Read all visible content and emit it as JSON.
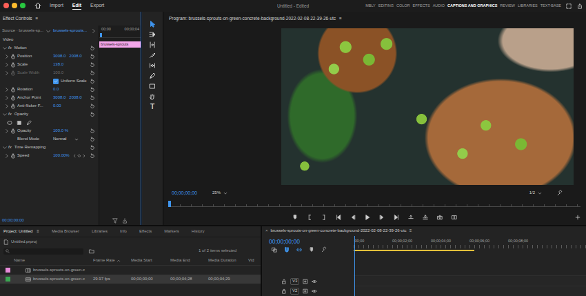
{
  "menu_bar": {
    "tabs": [
      {
        "label": "Import",
        "selected": false
      },
      {
        "label": "Edit",
        "selected": true
      },
      {
        "label": "Export",
        "selected": false
      }
    ],
    "title": "Untitled - Edited",
    "workspaces": [
      {
        "label": "MBLY",
        "selected": false
      },
      {
        "label": "EDITING",
        "selected": false
      },
      {
        "label": "COLOR",
        "selected": false
      },
      {
        "label": "EFFECTS",
        "selected": false
      },
      {
        "label": "AUDIO",
        "selected": false
      },
      {
        "label": "CAPTIONS AND GRAPHICS",
        "selected": true
      },
      {
        "label": "REVIEW",
        "selected": false
      },
      {
        "label": "LIBRARIES",
        "selected": false
      },
      {
        "label": "TEXT-BASE",
        "selected": false
      }
    ]
  },
  "effect_controls": {
    "title": "Effect Controls",
    "menu": "≡",
    "source": "Source · brussels-sp...",
    "clip": "brussels-sprouts...",
    "ruler": [
      "00;00",
      "00;00;04"
    ],
    "clip_bar": "brussels-sprouts",
    "timecode": "00;00;00;00",
    "rows": [
      {
        "kind": "section",
        "label": "Video"
      },
      {
        "kind": "effect",
        "fx": "fx",
        "label": "Motion",
        "expanded": true
      },
      {
        "kind": "param",
        "label": "Position",
        "values": [
          "3008.0",
          "2008.0"
        ],
        "expanded": false,
        "disabled": false,
        "keyframe_nav": false
      },
      {
        "kind": "param",
        "label": "Scale",
        "values": [
          "138.0"
        ],
        "expanded": false,
        "disabled": false,
        "keyframe_nav": false
      },
      {
        "kind": "param",
        "label": "Scale Width",
        "values": [
          "100.0"
        ],
        "expanded": false,
        "disabled": true,
        "keyframe_nav": false
      },
      {
        "kind": "checkbox",
        "label": "Uniform Scale",
        "checked": true
      },
      {
        "kind": "param",
        "label": "Rotation",
        "values": [
          "0.0"
        ],
        "expanded": false,
        "disabled": false,
        "keyframe_nav": false
      },
      {
        "kind": "param",
        "label": "Anchor Point",
        "values": [
          "3008.0",
          "2008.0"
        ],
        "expanded": false,
        "disabled": false,
        "keyframe_nav": false
      },
      {
        "kind": "param",
        "label": "Anti-flicker F...",
        "values": [
          "0.00"
        ],
        "expanded": false,
        "disabled": false,
        "keyframe_nav": false
      },
      {
        "kind": "effect",
        "fx": "fx",
        "label": "Opacity",
        "expanded": true
      },
      {
        "kind": "masks"
      },
      {
        "kind": "param",
        "label": "Opacity",
        "values": [
          "100.0 %"
        ],
        "expanded": false,
        "disabled": false,
        "keyframe_nav": false
      },
      {
        "kind": "select",
        "label": "Blend Mode",
        "value": "Normal"
      },
      {
        "kind": "effect",
        "fx": "fx",
        "label": "Time Remapping",
        "expanded": true
      },
      {
        "kind": "param",
        "label": "Speed",
        "values": [
          "100.00%"
        ],
        "expanded": false,
        "disabled": false,
        "keyframe_nav": true
      }
    ]
  },
  "tools": [
    {
      "kind": "selection",
      "selected": true
    },
    {
      "kind": "track-select",
      "selected": false
    },
    {
      "kind": "ripple",
      "selected": false
    },
    {
      "kind": "razor",
      "selected": false
    },
    {
      "kind": "slip",
      "selected": false
    },
    {
      "kind": "pen",
      "selected": false
    },
    {
      "kind": "rectangle",
      "selected": false
    },
    {
      "kind": "hand",
      "selected": false
    },
    {
      "kind": "type",
      "glyph": "T",
      "selected": false
    }
  ],
  "program": {
    "title": "Program: brussels-sprouts-on-green-concrete-background-2022-02-08-22-39-26-utc",
    "menu": "≡",
    "timecode": "00;00;00;00",
    "zoom": "25%",
    "resolution": "1/2",
    "playhead": 0
  },
  "project": {
    "tabs": [
      {
        "label": "Project: Untitled",
        "selected": true
      },
      {
        "label": "Media Browser",
        "selected": false
      },
      {
        "label": "Libraries",
        "selected": false
      },
      {
        "label": "Info",
        "selected": false
      },
      {
        "label": "Effects",
        "selected": false
      },
      {
        "label": "Markers",
        "selected": false
      },
      {
        "label": "History",
        "selected": false
      }
    ],
    "menu": "≡",
    "file": "Untitled.prproj",
    "count": "1 of 2 items selected",
    "columns": [
      {
        "label": "Name",
        "sorted": false
      },
      {
        "label": "Frame Rate",
        "sorted": true
      },
      {
        "label": "Media Start",
        "sorted": false
      },
      {
        "label": "Media End",
        "sorted": false
      },
      {
        "label": "Media Duration",
        "sorted": false
      },
      {
        "label": "Vid",
        "sorted": false
      }
    ],
    "rows": [
      {
        "kind": "sequence",
        "name": "brussels-sprouts-on-green-c",
        "color": "#e68ad8",
        "selected": false,
        "cells": []
      },
      {
        "kind": "clip",
        "name": "brussels-sprouts-on-green-c",
        "color": "#3aa752",
        "selected": true,
        "cells": [
          "29.97 fps",
          "00;00;00;00",
          "00;00;04;28",
          "00;00;04;29"
        ]
      }
    ]
  },
  "timeline": {
    "close": "×",
    "title": "brussels-sprouts-on-green-concrete-background-2022-02-08-22-39-26-utc",
    "menu": "≡",
    "timecode": "00;00;00;00",
    "toggles": [
      {
        "kind": "nest",
        "on": false
      },
      {
        "kind": "snap",
        "on": true
      },
      {
        "kind": "linked",
        "on": true
      },
      {
        "kind": "marker",
        "on": false
      },
      {
        "kind": "wrench",
        "on": false
      }
    ],
    "ruler": [
      ":00;00",
      "00;00;02;00",
      "00;00;04;00",
      "00;00;06;00",
      "00;00;08;00"
    ],
    "work_area": 0.52,
    "playhead": 0,
    "tracks": [
      {
        "label": "V3"
      },
      {
        "label": "V2"
      }
    ]
  }
}
